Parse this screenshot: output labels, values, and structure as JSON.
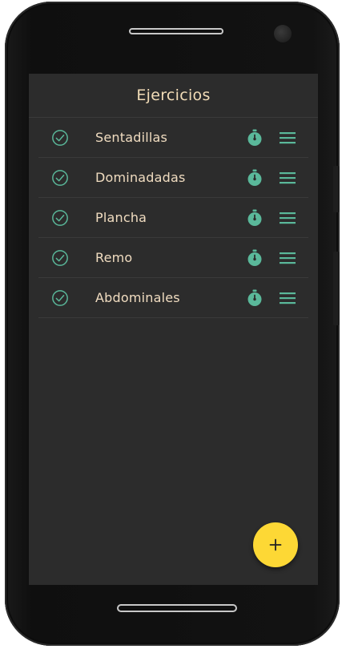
{
  "app_bar": {
    "title": "Ejercicios"
  },
  "exercises": [
    {
      "name": "Sentadillas",
      "status_icon": "check-circle-icon",
      "timer_icon": "stopwatch-icon",
      "reorder_icon": "drag-handle-icon"
    },
    {
      "name": "Dominadadas",
      "status_icon": "check-circle-icon",
      "timer_icon": "stopwatch-icon",
      "reorder_icon": "drag-handle-icon"
    },
    {
      "name": "Plancha",
      "status_icon": "check-circle-icon",
      "timer_icon": "stopwatch-icon",
      "reorder_icon": "drag-handle-icon"
    },
    {
      "name": "Remo",
      "status_icon": "check-circle-icon",
      "timer_icon": "stopwatch-icon",
      "reorder_icon": "drag-handle-icon"
    },
    {
      "name": "Abdominales",
      "status_icon": "check-circle-icon",
      "timer_icon": "stopwatch-icon",
      "reorder_icon": "drag-handle-icon"
    }
  ],
  "fab": {
    "icon": "plus-icon"
  },
  "colors": {
    "background": "#2c2c2c",
    "accent": "#5ab89a",
    "text": "#f0dcc0",
    "fab": "#fdd835"
  }
}
